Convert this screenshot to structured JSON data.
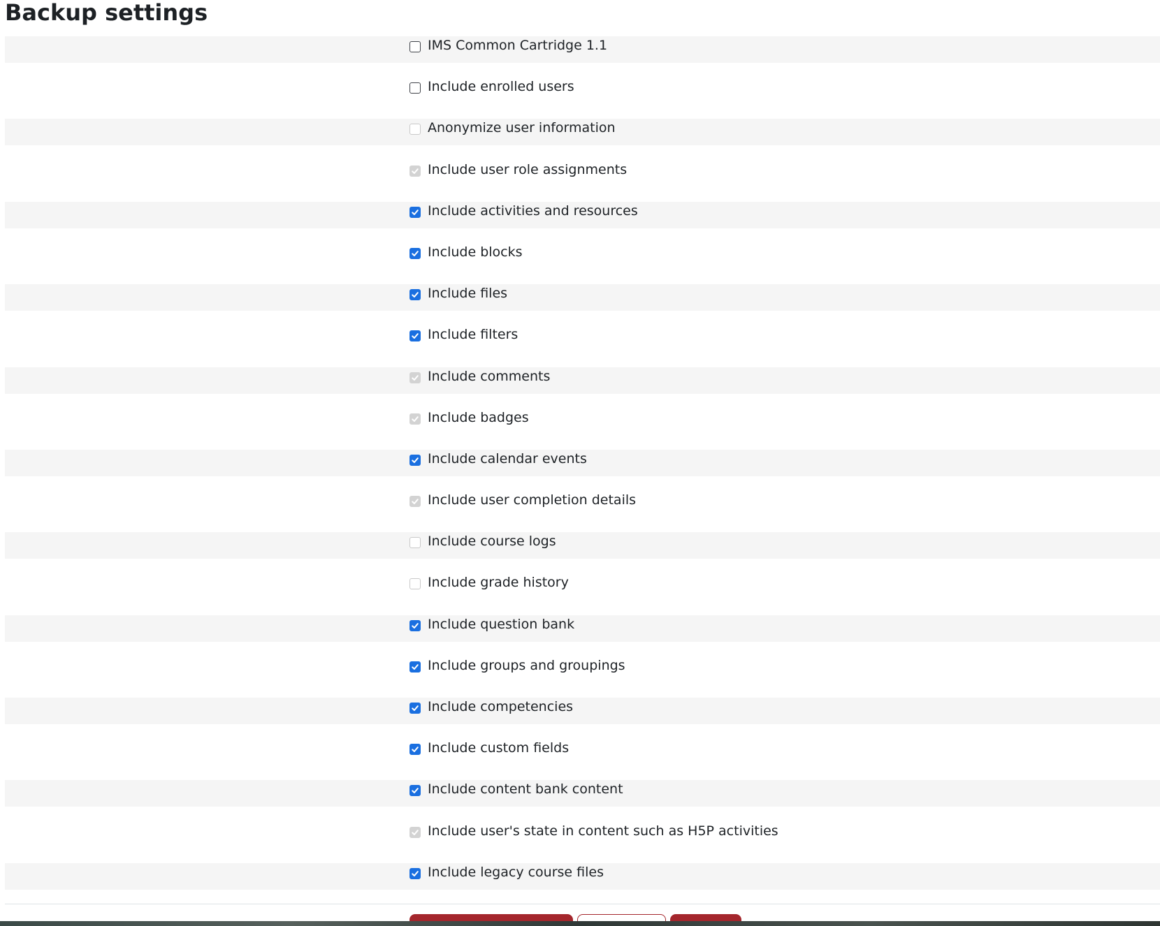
{
  "page": {
    "title": "Backup settings"
  },
  "settings": [
    {
      "label": "IMS Common Cartridge 1.1",
      "checked": false,
      "disabled": false
    },
    {
      "label": "Include enrolled users",
      "checked": false,
      "disabled": false
    },
    {
      "label": "Anonymize user information",
      "checked": false,
      "disabled": true
    },
    {
      "label": "Include user role assignments",
      "checked": true,
      "disabled": true
    },
    {
      "label": "Include activities and resources",
      "checked": true,
      "disabled": false
    },
    {
      "label": "Include blocks",
      "checked": true,
      "disabled": false
    },
    {
      "label": "Include files",
      "checked": true,
      "disabled": false
    },
    {
      "label": "Include filters",
      "checked": true,
      "disabled": false
    },
    {
      "label": "Include comments",
      "checked": true,
      "disabled": true
    },
    {
      "label": "Include badges",
      "checked": true,
      "disabled": true
    },
    {
      "label": "Include calendar events",
      "checked": true,
      "disabled": false
    },
    {
      "label": "Include user completion details",
      "checked": true,
      "disabled": true
    },
    {
      "label": "Include course logs",
      "checked": false,
      "disabled": true
    },
    {
      "label": "Include grade history",
      "checked": false,
      "disabled": true
    },
    {
      "label": "Include question bank",
      "checked": true,
      "disabled": false
    },
    {
      "label": "Include groups and groupings",
      "checked": true,
      "disabled": false
    },
    {
      "label": "Include competencies",
      "checked": true,
      "disabled": false
    },
    {
      "label": "Include custom fields",
      "checked": true,
      "disabled": false
    },
    {
      "label": "Include content bank content",
      "checked": true,
      "disabled": false
    },
    {
      "label": "Include user's state in content such as H5P activities",
      "checked": true,
      "disabled": true
    },
    {
      "label": "Include legacy course files",
      "checked": true,
      "disabled": false
    }
  ],
  "colors": {
    "checkbox_checked": "#1a6fe0",
    "checkbox_disabled": "#d3d3d3",
    "button_primary": "#a4262c",
    "row_stripe": "#f5f5f5"
  }
}
